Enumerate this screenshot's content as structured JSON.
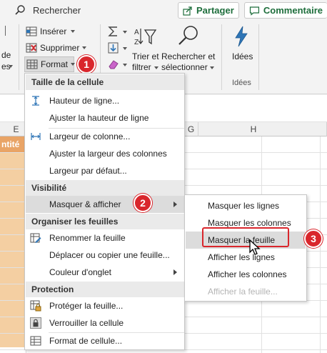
{
  "topbar": {
    "search_placeholder": "Rechercher",
    "share_label": "Partager",
    "comment_label": "Commentaire"
  },
  "ribbon": {
    "left_partial_1": "de",
    "left_partial_2": "es",
    "insert_label": "Insérer",
    "delete_label": "Supprimer",
    "format_label": "Format",
    "sort_label_1": "Trier et",
    "sort_label_2": "filtrer",
    "find_label_1": "Rechercher et",
    "find_label_2": "sélectionner",
    "ideas_label": "Idées",
    "ideas_group_label": "Idées"
  },
  "badges": {
    "b1": "1",
    "b2": "2",
    "b3": "3"
  },
  "sheet": {
    "col_e": "E",
    "col_g": "G",
    "col_h": "H",
    "header_partial": "ntité"
  },
  "menu": {
    "sec_cell_size": "Taille de la cellule",
    "row_height": "Hauteur de ligne...",
    "autofit_row": "Ajuster la hauteur de ligne",
    "col_width": "Largeur de colonne...",
    "autofit_col": "Ajuster la largeur des colonnes",
    "default_width": "Largeur par défaut...",
    "sec_visibility": "Visibilité",
    "hide_unhide": "Masquer & afficher",
    "sec_organize": "Organiser les feuilles",
    "rename_sheet": "Renommer la feuille",
    "move_copy": "Déplacer ou copier une feuille...",
    "tab_color": "Couleur d'onglet",
    "sec_protection": "Protection",
    "protect_sheet": "Protéger la feuille...",
    "lock_cell": "Verrouiller la cellule",
    "format_cells": "Format de cellule..."
  },
  "submenu": {
    "hide_rows": "Masquer les lignes",
    "hide_cols": "Masquer les colonnes",
    "hide_sheet": "Masquer la feuille",
    "show_rows": "Afficher les lignes",
    "show_cols": "Afficher les colonnes",
    "show_sheet": "Afficher la feuille..."
  },
  "colors": {
    "accent_green": "#1e6e3c",
    "badge_red": "#d9262c",
    "header_orange": "#e9a466",
    "cell_orange": "#f4cfa2"
  }
}
